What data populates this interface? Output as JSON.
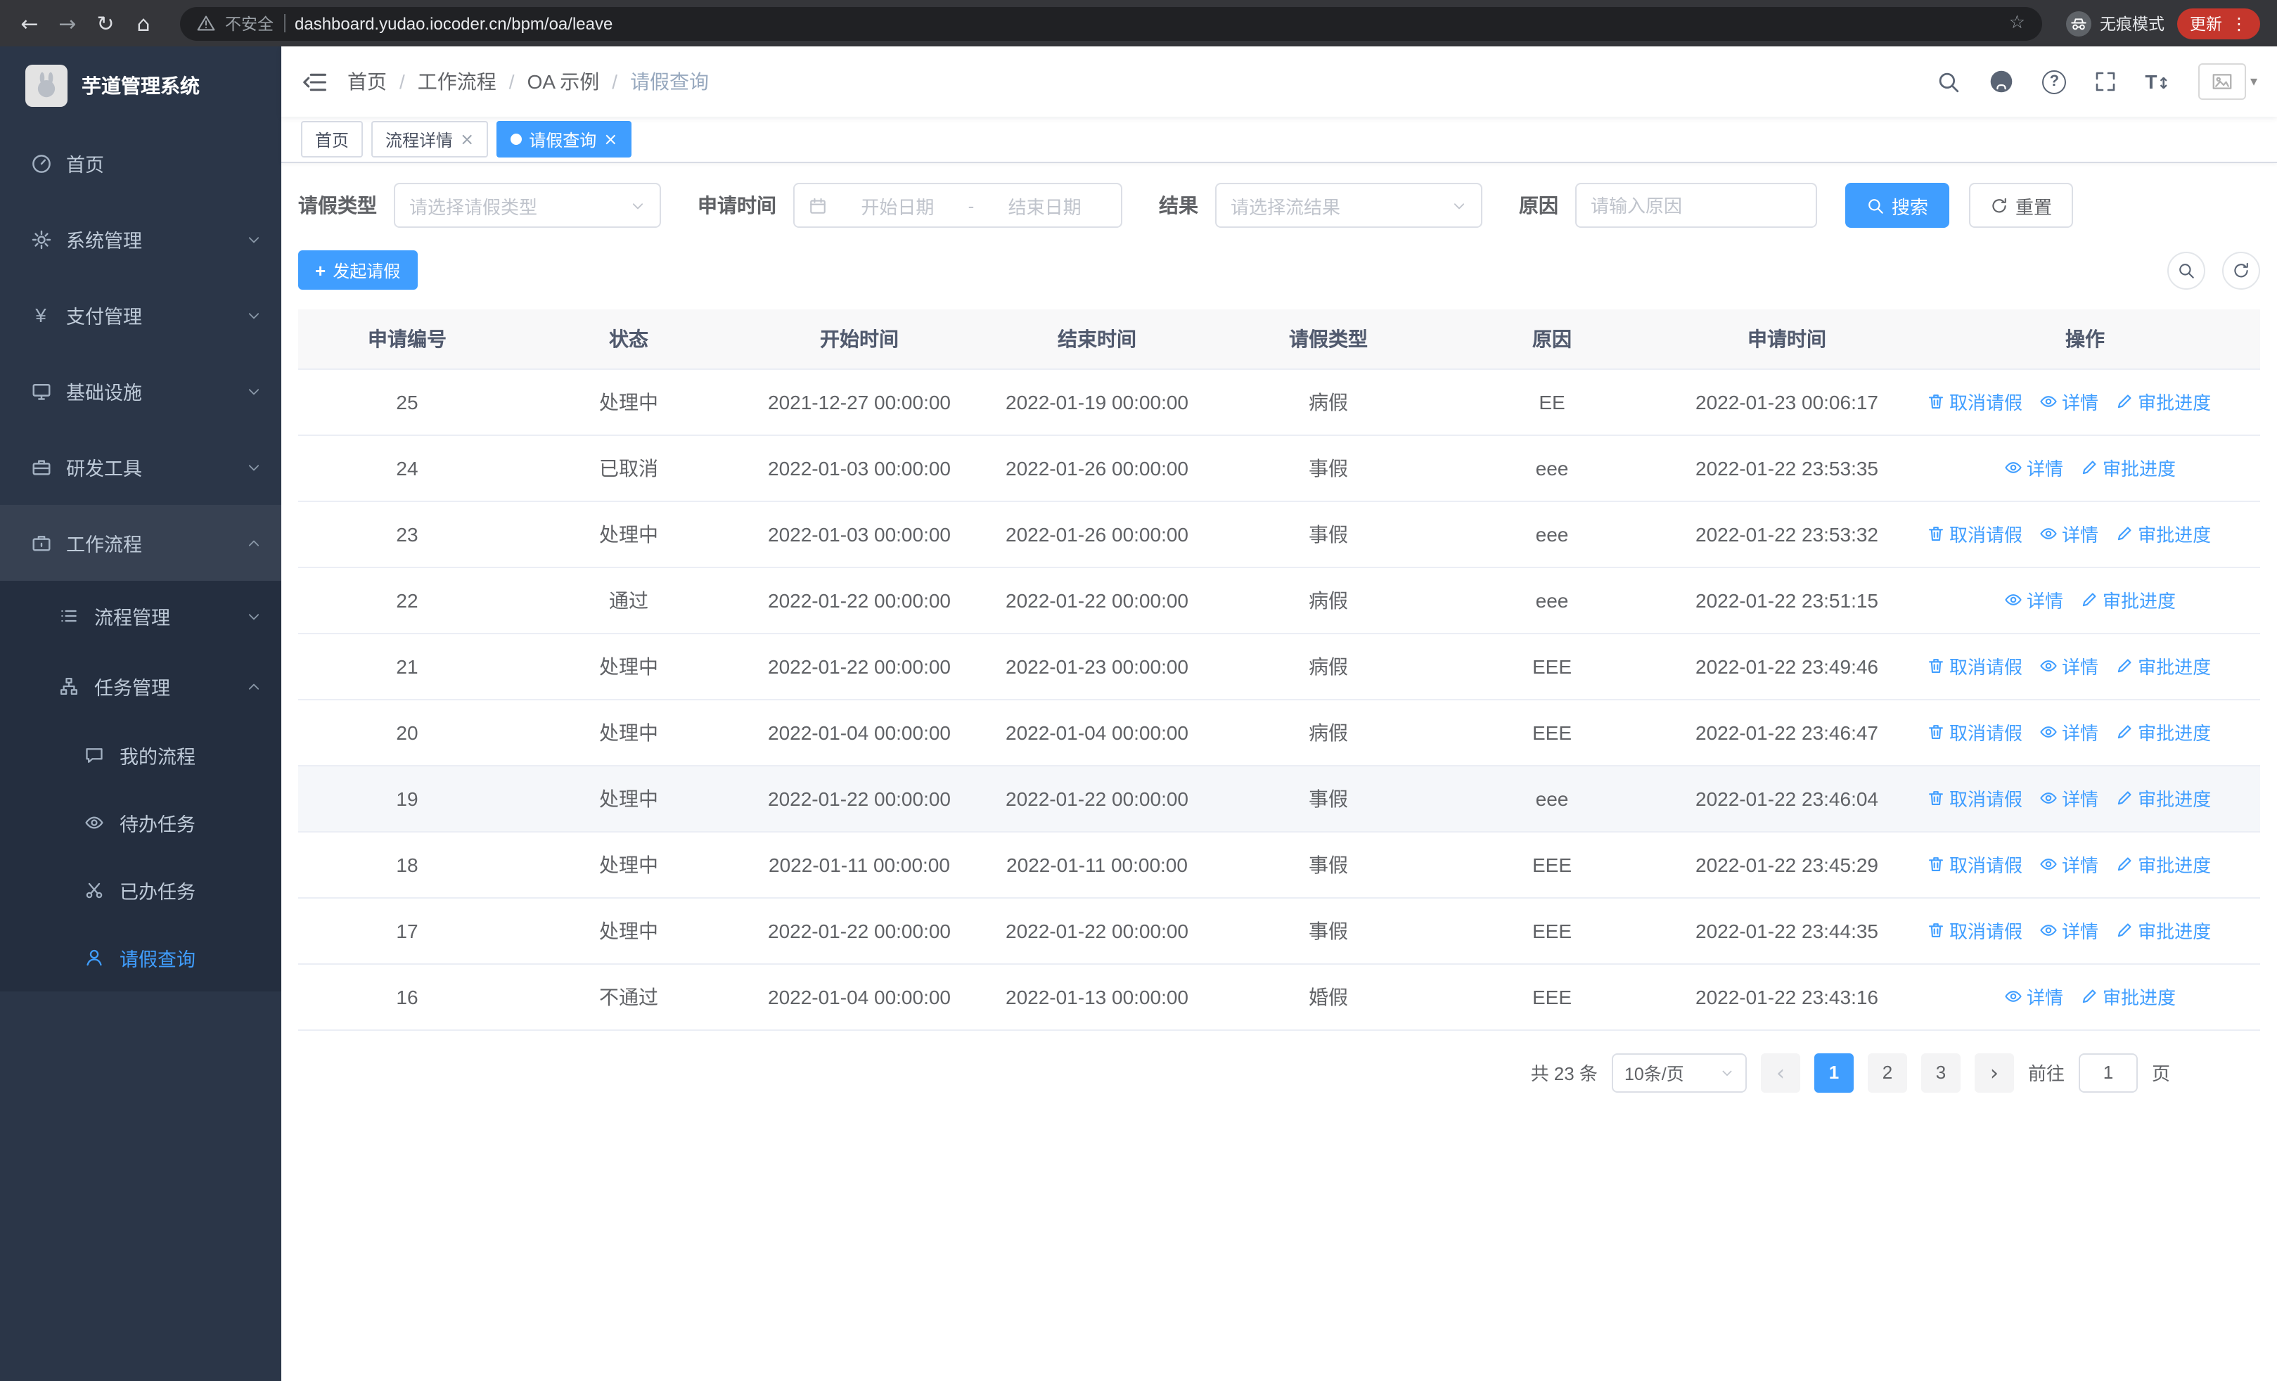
{
  "browser": {
    "security_label": "不安全",
    "url": "dashboard.yudao.iocoder.cn/bpm/oa/leave",
    "incognito_label": "无痕模式",
    "update_label": "更新"
  },
  "sidebar": {
    "title": "芋道管理系统",
    "items": [
      {
        "label": "首页"
      },
      {
        "label": "系统管理"
      },
      {
        "label": "支付管理"
      },
      {
        "label": "基础设施"
      },
      {
        "label": "研发工具"
      },
      {
        "label": "工作流程"
      },
      {
        "label": "流程管理"
      },
      {
        "label": "任务管理"
      },
      {
        "label": "我的流程"
      },
      {
        "label": "待办任务"
      },
      {
        "label": "已办任务"
      },
      {
        "label": "请假查询"
      }
    ]
  },
  "breadcrumb": [
    "首页",
    "工作流程",
    "OA 示例",
    "请假查询"
  ],
  "tabs": [
    {
      "label": "首页"
    },
    {
      "label": "流程详情"
    },
    {
      "label": "请假查询"
    }
  ],
  "filters": {
    "type_label": "请假类型",
    "type_placeholder": "请选择请假类型",
    "time_label": "申请时间",
    "start_placeholder": "开始日期",
    "range_separator": "-",
    "end_placeholder": "结束日期",
    "result_label": "结果",
    "result_placeholder": "请选择流结果",
    "reason_label": "原因",
    "reason_placeholder": "请输入原因",
    "search_label": "搜索",
    "reset_label": "重置"
  },
  "toolbar": {
    "create_label": "发起请假"
  },
  "table": {
    "columns": [
      "申请编号",
      "状态",
      "开始时间",
      "结束时间",
      "请假类型",
      "原因",
      "申请时间",
      "操作"
    ],
    "action_labels": {
      "cancel": "取消请假",
      "detail": "详情",
      "progress": "审批进度"
    },
    "rows": [
      {
        "id": "25",
        "status": "处理中",
        "start": "2021-12-27 00:00:00",
        "end": "2022-01-19 00:00:00",
        "type": "病假",
        "reason": "EE",
        "apply_time": "2022-01-23 00:06:17",
        "actions": [
          "cancel",
          "detail",
          "progress"
        ]
      },
      {
        "id": "24",
        "status": "已取消",
        "start": "2022-01-03 00:00:00",
        "end": "2022-01-26 00:00:00",
        "type": "事假",
        "reason": "eee",
        "apply_time": "2022-01-22 23:53:35",
        "actions": [
          "detail",
          "progress"
        ]
      },
      {
        "id": "23",
        "status": "处理中",
        "start": "2022-01-03 00:00:00",
        "end": "2022-01-26 00:00:00",
        "type": "事假",
        "reason": "eee",
        "apply_time": "2022-01-22 23:53:32",
        "actions": [
          "cancel",
          "detail",
          "progress"
        ]
      },
      {
        "id": "22",
        "status": "通过",
        "start": "2022-01-22 00:00:00",
        "end": "2022-01-22 00:00:00",
        "type": "病假",
        "reason": "eee",
        "apply_time": "2022-01-22 23:51:15",
        "actions": [
          "detail",
          "progress"
        ]
      },
      {
        "id": "21",
        "status": "处理中",
        "start": "2022-01-22 00:00:00",
        "end": "2022-01-23 00:00:00",
        "type": "病假",
        "reason": "EEE",
        "apply_time": "2022-01-22 23:49:46",
        "actions": [
          "cancel",
          "detail",
          "progress"
        ]
      },
      {
        "id": "20",
        "status": "处理中",
        "start": "2022-01-04 00:00:00",
        "end": "2022-01-04 00:00:00",
        "type": "病假",
        "reason": "EEE",
        "apply_time": "2022-01-22 23:46:47",
        "actions": [
          "cancel",
          "detail",
          "progress"
        ]
      },
      {
        "id": "19",
        "status": "处理中",
        "start": "2022-01-22 00:00:00",
        "end": "2022-01-22 00:00:00",
        "type": "事假",
        "reason": "eee",
        "apply_time": "2022-01-22 23:46:04",
        "actions": [
          "cancel",
          "detail",
          "progress"
        ],
        "highlighted": true
      },
      {
        "id": "18",
        "status": "处理中",
        "start": "2022-01-11 00:00:00",
        "end": "2022-01-11 00:00:00",
        "type": "事假",
        "reason": "EEE",
        "apply_time": "2022-01-22 23:45:29",
        "actions": [
          "cancel",
          "detail",
          "progress"
        ]
      },
      {
        "id": "17",
        "status": "处理中",
        "start": "2022-01-22 00:00:00",
        "end": "2022-01-22 00:00:00",
        "type": "事假",
        "reason": "EEE",
        "apply_time": "2022-01-22 23:44:35",
        "actions": [
          "cancel",
          "detail",
          "progress"
        ]
      },
      {
        "id": "16",
        "status": "不通过",
        "start": "2022-01-04 00:00:00",
        "end": "2022-01-13 00:00:00",
        "type": "婚假",
        "reason": "EEE",
        "apply_time": "2022-01-22 23:43:16",
        "actions": [
          "detail",
          "progress"
        ]
      }
    ]
  },
  "pagination": {
    "total": "共 23 条",
    "page_size": "10条/页",
    "pages": [
      "1",
      "2",
      "3"
    ],
    "goto_label": "前往",
    "goto_value": "1",
    "page_unit": "页"
  }
}
